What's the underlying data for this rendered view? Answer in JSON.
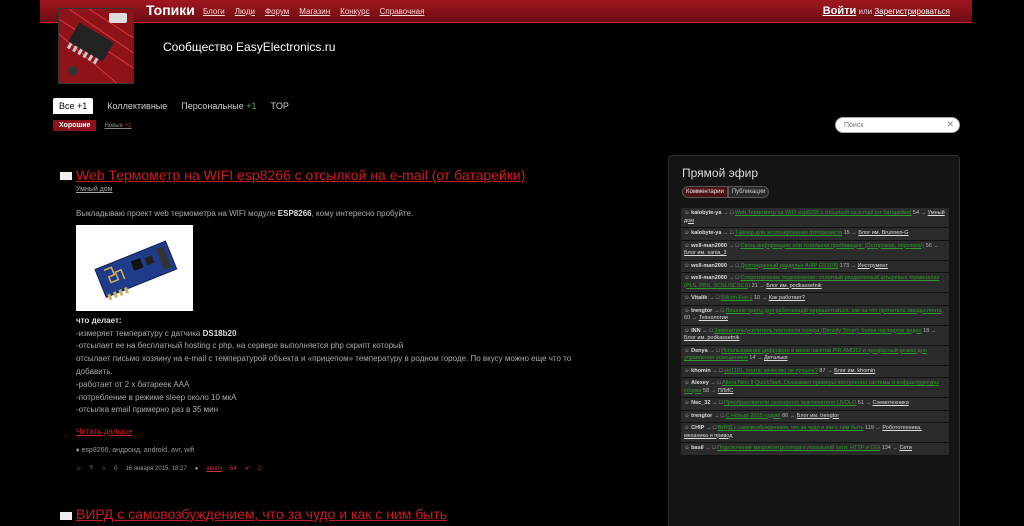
{
  "header": {
    "brand": "Топики",
    "nav": [
      "Блоги",
      "Люди",
      "Форум",
      "Магазин",
      "Конкурс",
      "Справочная"
    ],
    "login": "Войти",
    "or": "или",
    "register": "Зарегистрироваться"
  },
  "site": {
    "title": "Сообщество EasyElectronics.ru"
  },
  "tabs": {
    "all_label": "Все",
    "all_count": "+1",
    "collective": "Коллективные",
    "personal": "Персональные",
    "personal_count": "+1",
    "top": "TOP",
    "good": "Хорошие",
    "new_label": "Новые",
    "new_count": "+1"
  },
  "search": {
    "placeholder": "Поиск",
    "clear": "✕"
  },
  "post1": {
    "title": "Web Термометр на WIFI esp8266 с отсылкой на e-mail (от батарейки)",
    "blog": "Умный дом",
    "intro_a": "Выкладываю проект web термометра на WIFI модуле ",
    "intro_b": "ESP8266",
    "intro_c": ", кому интересно пробуйте.",
    "does_label": "что делает:",
    "line1_a": "-измеряет температуру с датчика ",
    "line1_b": "DS18b20",
    "line2": "-отсылает ее на бесплатный hosting с php, на сервере выполняется php скрипт который",
    "line3": "отсылает письмо хозяину на e-mail с температурой объекта и «прицепом» температуру в родном городе. По вкусу можно еще что то",
    "line4": "добавить.",
    "line5": "-работает от 2 х батареек ААА",
    "line6": "-потребление в режиме sleep около 10 мкА",
    "line7": "-отсылка email примерно раз в 35 мин",
    "read_more": "Читать дальше",
    "tags": "esp8266, андроид, android, avr, wifi",
    "rating": "?",
    "favorites": "0",
    "date": "16 января 2015, 18:27",
    "author": "alexhi",
    "votes": "54",
    "comments": "2"
  },
  "post2": {
    "title": "ВИРД с самовозбуждением, что за чудо и как с ним быть"
  },
  "sidebar": {
    "title": "Прямой эфир",
    "tab_comments": "Комментарии",
    "tab_posts": "Публикации",
    "items": [
      {
        "user": "kalobyte-ya",
        "topic": "Web Термометр на WIFI esp8266 с отсылкой на e-mail (от батарейки)",
        "count": "54",
        "blog": "Умный дом"
      },
      {
        "user": "kalobyte-ya",
        "topic": "Таймер для экспонирования фоторезиста",
        "count": "15",
        "blog": "Блог им. Brunnen-G"
      },
      {
        "user": "well-man2000",
        "topic": "Связь информацию или тотальная пробивация. (Осторожно, портянка!)",
        "count": "56",
        "blog": "Блог им. sania_3"
      },
      {
        "user": "well-man2000",
        "topic": "Долгожданный раздельн A-8P GS1100",
        "count": "173",
        "blog": "Инструмент"
      },
      {
        "user": "well-man2000",
        "topic": "Сопротивление подключения: сплетный разделяемый штыревых терминалах (PLS, PBS, SCSL/SCSCS)",
        "count": "21",
        "blog": "Блог им. podkassetnik"
      },
      {
        "user": "Vitalik",
        "topic": "Silicon Fun 1",
        "count": "10",
        "blog": "Как работает?"
      },
      {
        "user": "trengtor",
        "topic": "Лишние приты для работающий перешептаться, как на что пропитала звезды-лента",
        "count": "60",
        "blog": "Технологии"
      },
      {
        "user": "INN",
        "topic": "Заменитель/усилитель плотности тонера (Density Toner): более наглядное видео",
        "count": "18",
        "blog": "Блог им. podkassetnik"
      },
      {
        "user": "Denya",
        "topic": "Использование цифрового в меню пакетов PIR AMD12 и прекрасный режим для управления освещением",
        "count": "14",
        "blog": "Детальки"
      },
      {
        "user": "khomin",
        "topic": "stc1101, плата: качество не лучшее?",
        "count": "87",
        "blog": "Блог им. khomin"
      },
      {
        "user": "Alexey",
        "topic": "Altera Nios II QuickStart. Оказывает примеры построения системы и инфраструктуры сборки",
        "count": "58",
        "blog": "ПЛИС"
      },
      {
        "user": "Nec_32",
        "topic": "Преобразователи сенсорного выключателя LIVOLO",
        "count": "51",
        "blog": "Схемотехника"
      },
      {
        "user": "trengtor",
        "topic": "С Новым 2015 годом!",
        "count": "86",
        "blog": "Блог им. trengtor"
      },
      {
        "user": "CHIP",
        "topic": "ВИРД с самовозбуждением, что за чудо и как с ним быть",
        "count": "119",
        "blog": "Робототехника, механика и привод"
      },
      {
        "user": "basil",
        "topic": "Подключение микроконтроллера к локальной сети: HTTP и CGI",
        "count": "134",
        "blog": "Сети"
      }
    ]
  }
}
